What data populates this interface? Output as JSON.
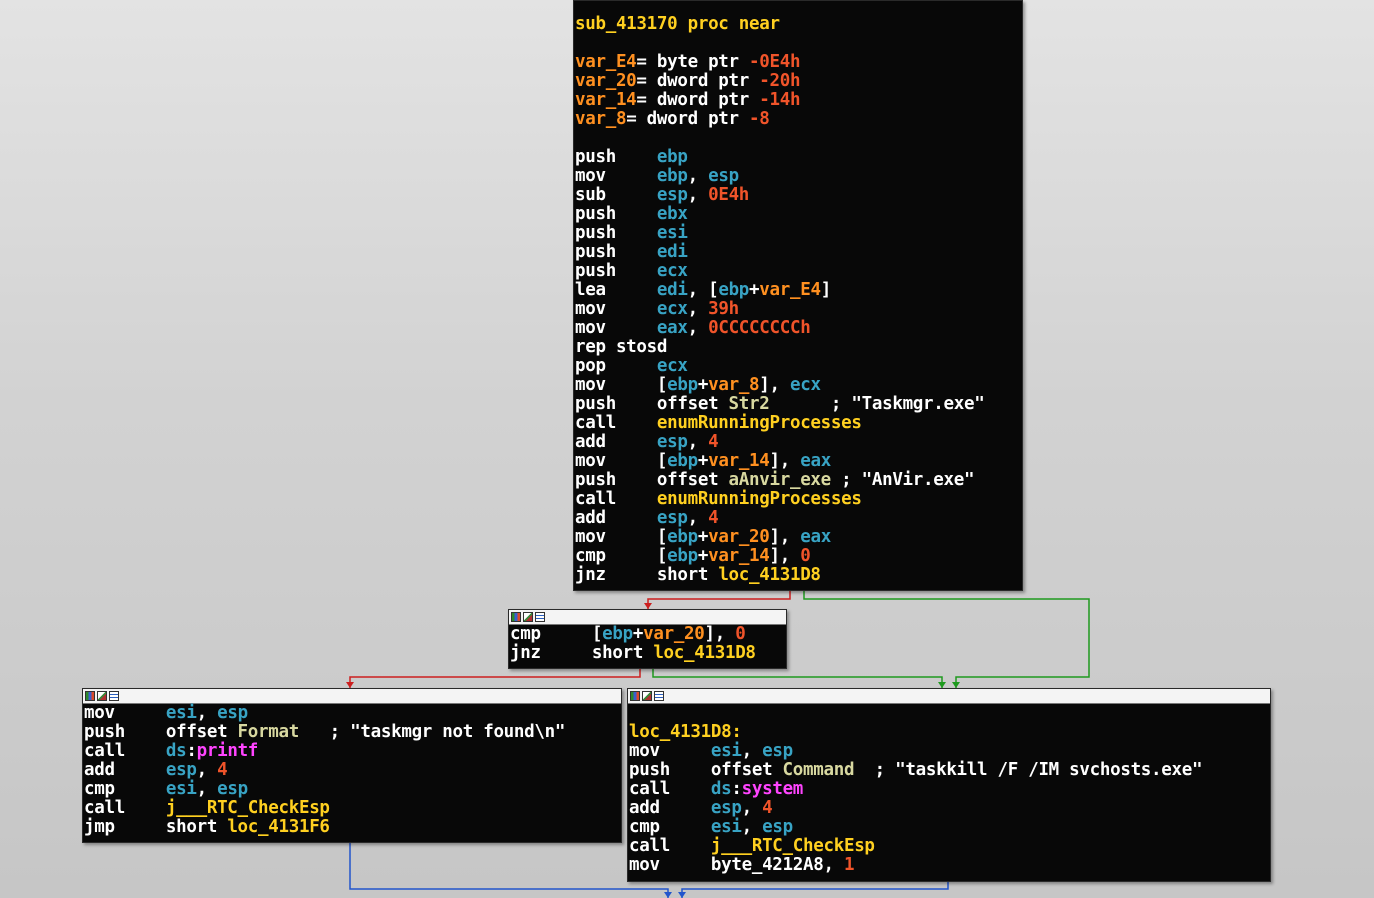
{
  "colors": {
    "background": "#d2d2d2",
    "node_bg": "#080808",
    "edge_true": "#1f9a1f",
    "edge_false": "#cc1f1f",
    "edge_uncond": "#2255cc"
  },
  "nodes": {
    "main": {
      "lines": [
        [
          {
            "c": "t-name",
            "t": "sub_413170 proc near"
          }
        ],
        [],
        [
          {
            "c": "t-var",
            "t": "var_E4"
          },
          {
            "c": "t-plain",
            "t": "= byte ptr "
          },
          {
            "c": "t-num",
            "t": "-0E4h"
          }
        ],
        [
          {
            "c": "t-var",
            "t": "var_20"
          },
          {
            "c": "t-plain",
            "t": "= dword ptr "
          },
          {
            "c": "t-num",
            "t": "-20h"
          }
        ],
        [
          {
            "c": "t-var",
            "t": "var_14"
          },
          {
            "c": "t-plain",
            "t": "= dword ptr "
          },
          {
            "c": "t-num",
            "t": "-14h"
          }
        ],
        [
          {
            "c": "t-var",
            "t": "var_8"
          },
          {
            "c": "t-plain",
            "t": "= dword ptr "
          },
          {
            "c": "t-num",
            "t": "-8"
          }
        ],
        [],
        [
          {
            "c": "t-ins",
            "t": "push    "
          },
          {
            "c": "t-reg",
            "t": "ebp"
          }
        ],
        [
          {
            "c": "t-ins",
            "t": "mov     "
          },
          {
            "c": "t-reg",
            "t": "ebp"
          },
          {
            "c": "t-plain",
            "t": ", "
          },
          {
            "c": "t-reg",
            "t": "esp"
          }
        ],
        [
          {
            "c": "t-ins",
            "t": "sub     "
          },
          {
            "c": "t-reg",
            "t": "esp"
          },
          {
            "c": "t-plain",
            "t": ", "
          },
          {
            "c": "t-num",
            "t": "0E4h"
          }
        ],
        [
          {
            "c": "t-ins",
            "t": "push    "
          },
          {
            "c": "t-reg",
            "t": "ebx"
          }
        ],
        [
          {
            "c": "t-ins",
            "t": "push    "
          },
          {
            "c": "t-reg",
            "t": "esi"
          }
        ],
        [
          {
            "c": "t-ins",
            "t": "push    "
          },
          {
            "c": "t-reg",
            "t": "edi"
          }
        ],
        [
          {
            "c": "t-ins",
            "t": "push    "
          },
          {
            "c": "t-reg",
            "t": "ecx"
          }
        ],
        [
          {
            "c": "t-ins",
            "t": "lea     "
          },
          {
            "c": "t-reg",
            "t": "edi"
          },
          {
            "c": "t-plain",
            "t": ", ["
          },
          {
            "c": "t-reg",
            "t": "ebp"
          },
          {
            "c": "t-plain",
            "t": "+"
          },
          {
            "c": "t-var",
            "t": "var_E4"
          },
          {
            "c": "t-plain",
            "t": "]"
          }
        ],
        [
          {
            "c": "t-ins",
            "t": "mov     "
          },
          {
            "c": "t-reg",
            "t": "ecx"
          },
          {
            "c": "t-plain",
            "t": ", "
          },
          {
            "c": "t-num",
            "t": "39h"
          }
        ],
        [
          {
            "c": "t-ins",
            "t": "mov     "
          },
          {
            "c": "t-reg",
            "t": "eax"
          },
          {
            "c": "t-plain",
            "t": ", "
          },
          {
            "c": "t-num",
            "t": "0CCCCCCCCh"
          }
        ],
        [
          {
            "c": "t-ins",
            "t": "rep stosd"
          }
        ],
        [
          {
            "c": "t-ins",
            "t": "pop     "
          },
          {
            "c": "t-reg",
            "t": "ecx"
          }
        ],
        [
          {
            "c": "t-ins",
            "t": "mov     "
          },
          {
            "c": "t-plain",
            "t": "["
          },
          {
            "c": "t-reg",
            "t": "ebp"
          },
          {
            "c": "t-plain",
            "t": "+"
          },
          {
            "c": "t-var",
            "t": "var_8"
          },
          {
            "c": "t-plain",
            "t": "], "
          },
          {
            "c": "t-reg",
            "t": "ecx"
          }
        ],
        [
          {
            "c": "t-ins",
            "t": "push    "
          },
          {
            "c": "t-plain",
            "t": "offset "
          },
          {
            "c": "t-str",
            "t": "Str2"
          },
          {
            "c": "t-plain",
            "t": "      ; \"Taskmgr.exe\""
          }
        ],
        [
          {
            "c": "t-ins",
            "t": "call    "
          },
          {
            "c": "t-name",
            "t": "enumRunningProcesses"
          }
        ],
        [
          {
            "c": "t-ins",
            "t": "add     "
          },
          {
            "c": "t-reg",
            "t": "esp"
          },
          {
            "c": "t-plain",
            "t": ", "
          },
          {
            "c": "t-num",
            "t": "4"
          }
        ],
        [
          {
            "c": "t-ins",
            "t": "mov     "
          },
          {
            "c": "t-plain",
            "t": "["
          },
          {
            "c": "t-reg",
            "t": "ebp"
          },
          {
            "c": "t-plain",
            "t": "+"
          },
          {
            "c": "t-var",
            "t": "var_14"
          },
          {
            "c": "t-plain",
            "t": "], "
          },
          {
            "c": "t-reg",
            "t": "eax"
          }
        ],
        [
          {
            "c": "t-ins",
            "t": "push    "
          },
          {
            "c": "t-plain",
            "t": "offset "
          },
          {
            "c": "t-str",
            "t": "aAnvir_exe"
          },
          {
            "c": "t-plain",
            "t": " ; \"AnVir.exe\""
          }
        ],
        [
          {
            "c": "t-ins",
            "t": "call    "
          },
          {
            "c": "t-name",
            "t": "enumRunningProcesses"
          }
        ],
        [
          {
            "c": "t-ins",
            "t": "add     "
          },
          {
            "c": "t-reg",
            "t": "esp"
          },
          {
            "c": "t-plain",
            "t": ", "
          },
          {
            "c": "t-num",
            "t": "4"
          }
        ],
        [
          {
            "c": "t-ins",
            "t": "mov     "
          },
          {
            "c": "t-plain",
            "t": "["
          },
          {
            "c": "t-reg",
            "t": "ebp"
          },
          {
            "c": "t-plain",
            "t": "+"
          },
          {
            "c": "t-var",
            "t": "var_20"
          },
          {
            "c": "t-plain",
            "t": "], "
          },
          {
            "c": "t-reg",
            "t": "eax"
          }
        ],
        [
          {
            "c": "t-ins",
            "t": "cmp     "
          },
          {
            "c": "t-plain",
            "t": "["
          },
          {
            "c": "t-reg",
            "t": "ebp"
          },
          {
            "c": "t-plain",
            "t": "+"
          },
          {
            "c": "t-var",
            "t": "var_14"
          },
          {
            "c": "t-plain",
            "t": "], "
          },
          {
            "c": "t-num",
            "t": "0"
          }
        ],
        [
          {
            "c": "t-ins",
            "t": "jnz     "
          },
          {
            "c": "t-plain",
            "t": "short "
          },
          {
            "c": "t-lbl",
            "t": "loc_4131D8"
          }
        ]
      ]
    },
    "cmp2": {
      "lines": [
        [
          {
            "c": "t-ins",
            "t": "cmp     "
          },
          {
            "c": "t-plain",
            "t": "["
          },
          {
            "c": "t-reg",
            "t": "ebp"
          },
          {
            "c": "t-plain",
            "t": "+"
          },
          {
            "c": "t-var",
            "t": "var_20"
          },
          {
            "c": "t-plain",
            "t": "], "
          },
          {
            "c": "t-num",
            "t": "0"
          }
        ],
        [
          {
            "c": "t-ins",
            "t": "jnz     "
          },
          {
            "c": "t-plain",
            "t": "short "
          },
          {
            "c": "t-lbl",
            "t": "loc_4131D8"
          }
        ]
      ]
    },
    "notfound": {
      "lines": [
        [
          {
            "c": "t-ins",
            "t": "mov     "
          },
          {
            "c": "t-reg",
            "t": "esi"
          },
          {
            "c": "t-plain",
            "t": ", "
          },
          {
            "c": "t-reg",
            "t": "esp"
          }
        ],
        [
          {
            "c": "t-ins",
            "t": "push    "
          },
          {
            "c": "t-plain",
            "t": "offset "
          },
          {
            "c": "t-str",
            "t": "Format"
          },
          {
            "c": "t-plain",
            "t": "   ; \"taskmgr not found\\n\""
          }
        ],
        [
          {
            "c": "t-ins",
            "t": "call    "
          },
          {
            "c": "t-reg",
            "t": "ds"
          },
          {
            "c": "t-plain",
            "t": ":"
          },
          {
            "c": "t-ext",
            "t": "printf"
          }
        ],
        [
          {
            "c": "t-ins",
            "t": "add     "
          },
          {
            "c": "t-reg",
            "t": "esp"
          },
          {
            "c": "t-plain",
            "t": ", "
          },
          {
            "c": "t-num",
            "t": "4"
          }
        ],
        [
          {
            "c": "t-ins",
            "t": "cmp     "
          },
          {
            "c": "t-reg",
            "t": "esi"
          },
          {
            "c": "t-plain",
            "t": ", "
          },
          {
            "c": "t-reg",
            "t": "esp"
          }
        ],
        [
          {
            "c": "t-ins",
            "t": "call    "
          },
          {
            "c": "t-name",
            "t": "j___RTC_CheckEsp"
          }
        ],
        [
          {
            "c": "t-ins",
            "t": "jmp     "
          },
          {
            "c": "t-plain",
            "t": "short "
          },
          {
            "c": "t-lbl",
            "t": "loc_4131F6"
          }
        ]
      ]
    },
    "kill": {
      "lines": [
        [],
        [
          {
            "c": "t-lbl",
            "t": "loc_4131D8:"
          }
        ],
        [
          {
            "c": "t-ins",
            "t": "mov     "
          },
          {
            "c": "t-reg",
            "t": "esi"
          },
          {
            "c": "t-plain",
            "t": ", "
          },
          {
            "c": "t-reg",
            "t": "esp"
          }
        ],
        [
          {
            "c": "t-ins",
            "t": "push    "
          },
          {
            "c": "t-plain",
            "t": "offset "
          },
          {
            "c": "t-str",
            "t": "Command"
          },
          {
            "c": "t-plain",
            "t": "  ; \"taskkill /F /IM svchosts.exe\""
          }
        ],
        [
          {
            "c": "t-ins",
            "t": "call    "
          },
          {
            "c": "t-reg",
            "t": "ds"
          },
          {
            "c": "t-plain",
            "t": ":"
          },
          {
            "c": "t-ext",
            "t": "system"
          }
        ],
        [
          {
            "c": "t-ins",
            "t": "add     "
          },
          {
            "c": "t-reg",
            "t": "esp"
          },
          {
            "c": "t-plain",
            "t": ", "
          },
          {
            "c": "t-num",
            "t": "4"
          }
        ],
        [
          {
            "c": "t-ins",
            "t": "cmp     "
          },
          {
            "c": "t-reg",
            "t": "esi"
          },
          {
            "c": "t-plain",
            "t": ", "
          },
          {
            "c": "t-reg",
            "t": "esp"
          }
        ],
        [
          {
            "c": "t-ins",
            "t": "call    "
          },
          {
            "c": "t-name",
            "t": "j___RTC_CheckEsp"
          }
        ],
        [
          {
            "c": "t-ins",
            "t": "mov     "
          },
          {
            "c": "t-plain",
            "t": "byte_4212A8, "
          },
          {
            "c": "t-num",
            "t": "1"
          }
        ]
      ]
    }
  }
}
